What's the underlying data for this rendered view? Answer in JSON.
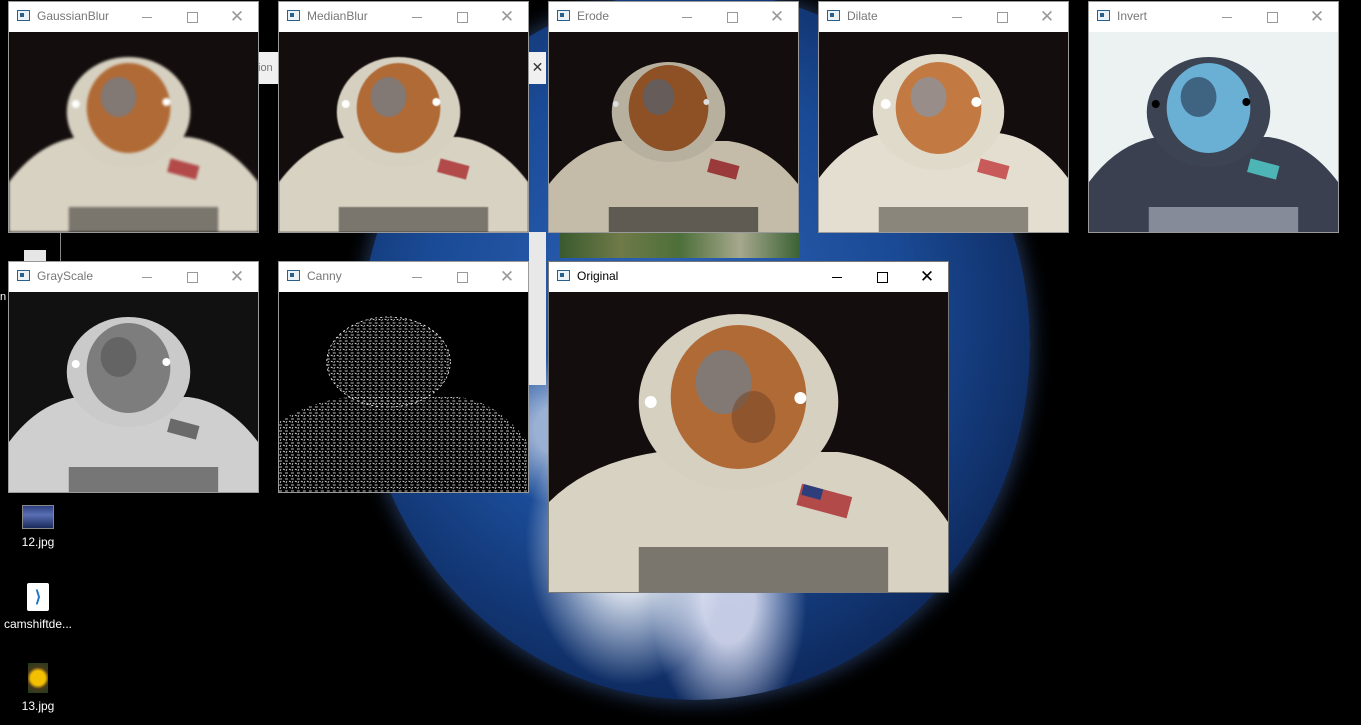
{
  "windows": {
    "gaussian": {
      "title": "GaussianBlur"
    },
    "median": {
      "title": "MedianBlur"
    },
    "erode": {
      "title": "Erode"
    },
    "dilate": {
      "title": "Dilate"
    },
    "invert": {
      "title": "Invert"
    },
    "grayscale": {
      "title": "GrayScale"
    },
    "canny": {
      "title": "Canny"
    },
    "original": {
      "title": "Original"
    }
  },
  "background": {
    "partial_window_text": "ion",
    "partial_window_close": "✕",
    "partial_desktop_label": "n"
  },
  "desktop_icons": [
    {
      "label": "12.jpg",
      "icon": "image-file-icon"
    },
    {
      "label": "camshiftde...",
      "icon": "vscode-file-icon"
    },
    {
      "label": "13.jpg",
      "icon": "image-file-icon"
    }
  ],
  "icons": {
    "minimize": "minimize-icon",
    "maximize": "maximize-icon",
    "close": "close-icon",
    "close_glyph": "✕"
  },
  "colors": {
    "desktop_bg": "#000000",
    "image_bg": "#130d0d",
    "suit": "#d8d2c2",
    "visor": "#b06a35"
  }
}
